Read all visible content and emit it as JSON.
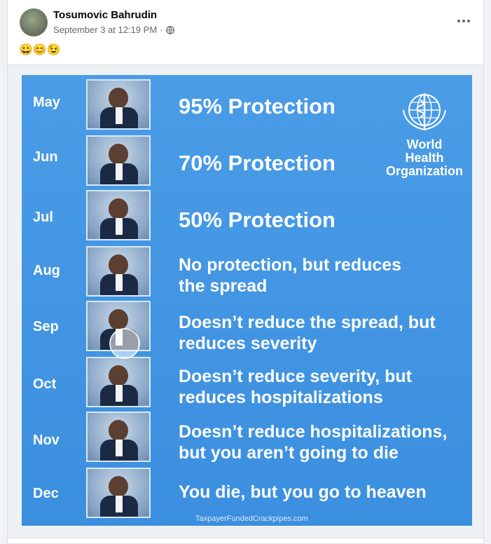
{
  "post": {
    "author": "Tosumovic Bahrudin",
    "timestamp": "September 3 at 12:19 PM",
    "separator": "·",
    "audience_icon": "globe-icon",
    "more_icon": "more-options-icon",
    "text": "😀😊😉"
  },
  "image": {
    "org_name_line1": "World Health",
    "org_name_line2": "Organization",
    "logo_icon": "who-emblem",
    "rows": [
      {
        "month": "May",
        "caption": "95% Protection"
      },
      {
        "month": "Jun",
        "caption": "70% Protection"
      },
      {
        "month": "Jul",
        "caption": "50% Protection"
      },
      {
        "month": "Aug",
        "caption": "No protection, but reduces the spread"
      },
      {
        "month": "Sep",
        "caption": "Doesn’t reduce the spread, but reduces severity"
      },
      {
        "month": "Oct",
        "caption": "Doesn’t reduce severity, but reduces hospitalizations"
      },
      {
        "month": "Nov",
        "caption": "Doesn’t reduce hospitalizations, but you aren’t going to die"
      },
      {
        "month": "Dec",
        "caption": "You die, but you go to heaven"
      }
    ],
    "footer": "TaxpayerFundedCrackpipes.com",
    "colors": {
      "background": "#3b8fdf",
      "text": "#ffffff"
    }
  }
}
